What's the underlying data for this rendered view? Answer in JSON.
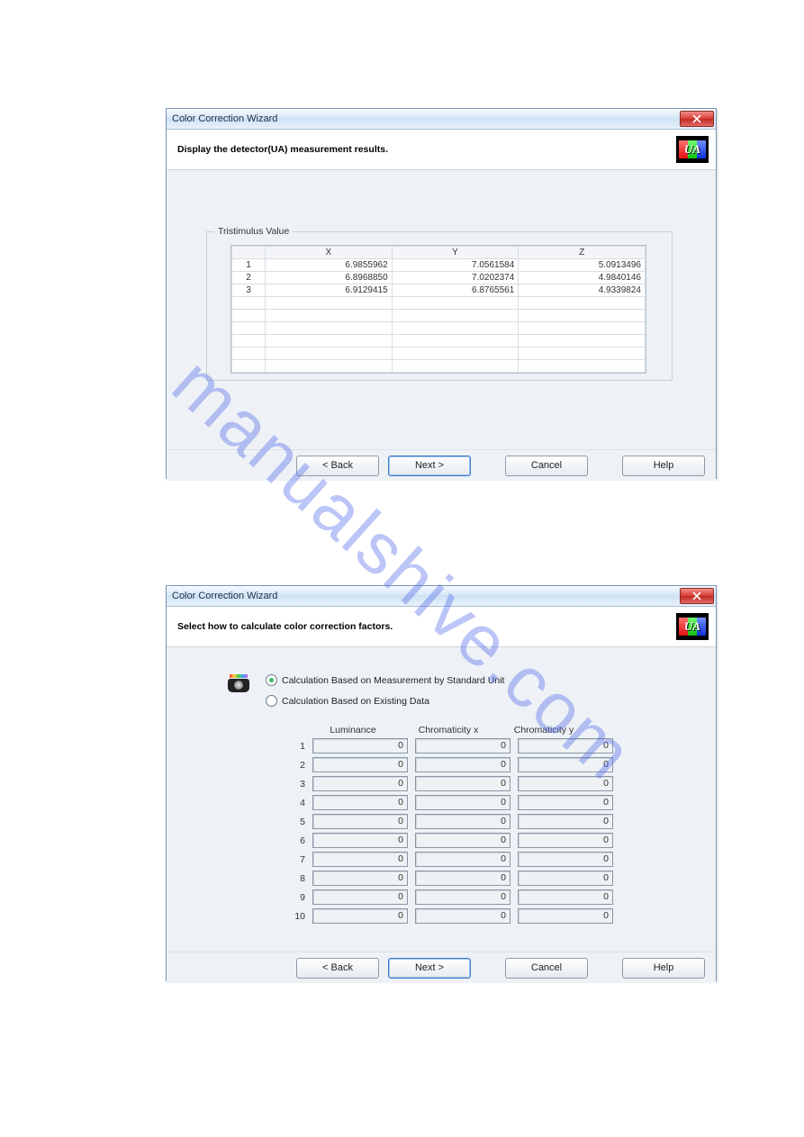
{
  "watermark": "manualshive.com",
  "dialog1": {
    "title": "Color Correction Wizard",
    "header": "Display the detector(UA) measurement results.",
    "groupbox_title": "Tristimulus Value",
    "columns": [
      "",
      "X",
      "Y",
      "Z"
    ],
    "rows": [
      {
        "n": "1",
        "x": "6.9855962",
        "y": "7.0561584",
        "z": "5.0913496"
      },
      {
        "n": "2",
        "x": "6.8968850",
        "y": "7.0202374",
        "z": "4.9840146"
      },
      {
        "n": "3",
        "x": "6.9129415",
        "y": "6.8765561",
        "z": "4.9339824"
      }
    ],
    "buttons": {
      "back": "< Back",
      "next": "Next >",
      "cancel": "Cancel",
      "help": "Help"
    }
  },
  "dialog2": {
    "title": "Color Correction Wizard",
    "header": "Select how to calculate color correction factors.",
    "radio1": "Calculation Based on Measurement by Standard Unit",
    "radio2": "Calculation Based on Existing Data",
    "columns": {
      "lum": "Luminance",
      "cx": "Chromaticity x",
      "cy": "Chromaticity y"
    },
    "rows": [
      {
        "n": "1",
        "l": "0",
        "x": "0",
        "y": "0"
      },
      {
        "n": "2",
        "l": "0",
        "x": "0",
        "y": "0"
      },
      {
        "n": "3",
        "l": "0",
        "x": "0",
        "y": "0"
      },
      {
        "n": "4",
        "l": "0",
        "x": "0",
        "y": "0"
      },
      {
        "n": "5",
        "l": "0",
        "x": "0",
        "y": "0"
      },
      {
        "n": "6",
        "l": "0",
        "x": "0",
        "y": "0"
      },
      {
        "n": "7",
        "l": "0",
        "x": "0",
        "y": "0"
      },
      {
        "n": "8",
        "l": "0",
        "x": "0",
        "y": "0"
      },
      {
        "n": "9",
        "l": "0",
        "x": "0",
        "y": "0"
      },
      {
        "n": "10",
        "l": "0",
        "x": "0",
        "y": "0"
      }
    ],
    "buttons": {
      "back": "< Back",
      "next": "Next >",
      "cancel": "Cancel",
      "help": "Help"
    }
  }
}
